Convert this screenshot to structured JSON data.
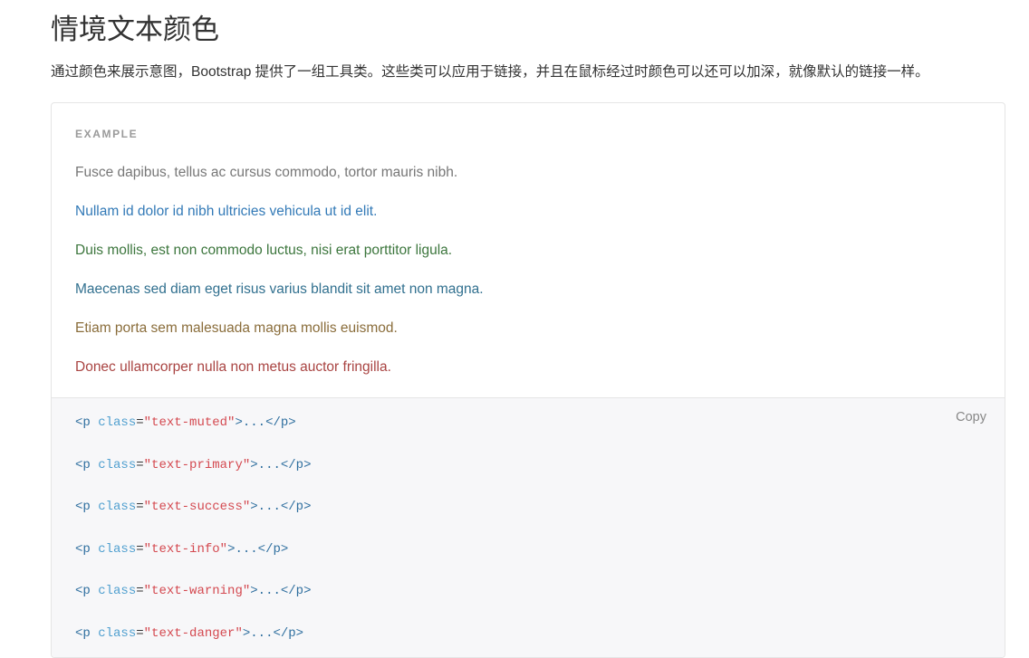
{
  "page": {
    "title": "情境文本颜色",
    "description": "通过颜色来展示意图，Bootstrap 提供了一组工具类。这些类可以应用于链接，并且在鼠标经过时颜色可以还可以加深，就像默认的链接一样。"
  },
  "example": {
    "label": "EXAMPLE",
    "paragraphs": [
      {
        "class": "text-muted",
        "color": "#777777",
        "text": "Fusce dapibus, tellus ac cursus commodo, tortor mauris nibh."
      },
      {
        "class": "text-primary",
        "color": "#337ab7",
        "text": "Nullam id dolor id nibh ultricies vehicula ut id elit."
      },
      {
        "class": "text-success",
        "color": "#3c763d",
        "text": "Duis mollis, est non commodo luctus, nisi erat porttitor ligula."
      },
      {
        "class": "text-info",
        "color": "#31708f",
        "text": "Maecenas sed diam eget risus varius blandit sit amet non magna."
      },
      {
        "class": "text-warning",
        "color": "#8a6d3b",
        "text": "Etiam porta sem malesuada magna mollis euismod."
      },
      {
        "class": "text-danger",
        "color": "#a94442",
        "text": "Donec ullamcorper nulla non metus auctor fringilla."
      }
    ]
  },
  "code": {
    "copy_label": "Copy",
    "lines": [
      {
        "tag_open": "<p ",
        "attr": "class",
        "eq": "=",
        "value": "\"text-muted\"",
        "tag_close": ">...</p>"
      },
      {
        "tag_open": "<p ",
        "attr": "class",
        "eq": "=",
        "value": "\"text-primary\"",
        "tag_close": ">...</p>"
      },
      {
        "tag_open": "<p ",
        "attr": "class",
        "eq": "=",
        "value": "\"text-success\"",
        "tag_close": ">...</p>"
      },
      {
        "tag_open": "<p ",
        "attr": "class",
        "eq": "=",
        "value": "\"text-info\"",
        "tag_close": ">...</p>"
      },
      {
        "tag_open": "<p ",
        "attr": "class",
        "eq": "=",
        "value": "\"text-warning\"",
        "tag_close": ">...</p>"
      },
      {
        "tag_open": "<p ",
        "attr": "class",
        "eq": "=",
        "value": "\"text-danger\"",
        "tag_close": ">...</p>"
      }
    ]
  },
  "colors": {
    "panel_border": "#e5e5e5",
    "code_background": "#f7f7f9",
    "label": "#9a9a9a",
    "copy": "#878787",
    "code_tag": "#2f6f9f",
    "code_attr": "#4f9fcf",
    "code_string": "#d44950"
  }
}
